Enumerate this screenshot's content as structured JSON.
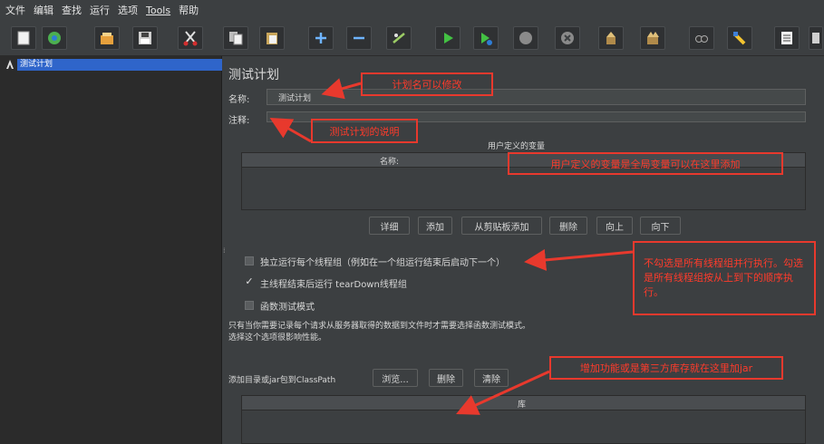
{
  "menu": [
    "文件",
    "编辑",
    "查找",
    "运行",
    "选项",
    "Tools",
    "帮助"
  ],
  "tree": {
    "root_label": "测试计划"
  },
  "panel": {
    "title": "测试计划",
    "name_label": "名称:",
    "name_value": "测试计划",
    "comment_label": "注释:",
    "comment_value": ""
  },
  "vars": {
    "title": "用户定义的变量",
    "column": "名称:",
    "buttons": [
      "详细",
      "添加",
      "从剪贴板添加",
      "删除",
      "向上",
      "向下"
    ]
  },
  "options": {
    "serial_label": "独立运行每个线程组（例如在一个组运行结束后启动下一个）",
    "serial_checked": false,
    "teardown_label": "主线程结束后运行 tearDown线程组",
    "teardown_checked": true,
    "functional_label": "函数测试模式",
    "functional_checked": false,
    "hint_line1": "只有当你需要记录每个请求从服务器取得的数据到文件时才需要选择函数测试模式。",
    "hint_line2": "选择这个选项很影响性能。"
  },
  "classpath": {
    "label": "添加目录或jar包到ClassPath",
    "browse": "浏览...",
    "delete": "删除",
    "clear": "清除",
    "column": "库"
  },
  "annotations": {
    "name_note": "计划名可以修改",
    "comment_note": "测试计划的说明",
    "vars_note": "用户定义的变量是全局变量可以在这里添加",
    "thread_note": "不勾选是所有线程组并行执行。勾选是所有线程组按从上到下的顺序执行。",
    "jar_note": "增加功能或是第三方库存就在这里加jar"
  },
  "colors": {
    "background": "#3c3f41",
    "tree_background": "#2b2b2b",
    "selection": "#2f65ca",
    "annotation": "#e8392d"
  },
  "toolbar_icons": [
    "new-icon",
    "templates-icon",
    "open-icon",
    "save-icon",
    "cut-icon",
    "copy-icon",
    "paste-icon",
    "expand-icon",
    "collapse-icon",
    "toggle-icon",
    "start-icon",
    "start-no-pause-icon",
    "stop-icon",
    "shutdown-icon",
    "clear-icon",
    "clear-all-icon",
    "search-icon",
    "reset-search-icon",
    "function-helper-icon",
    "help-icon"
  ]
}
